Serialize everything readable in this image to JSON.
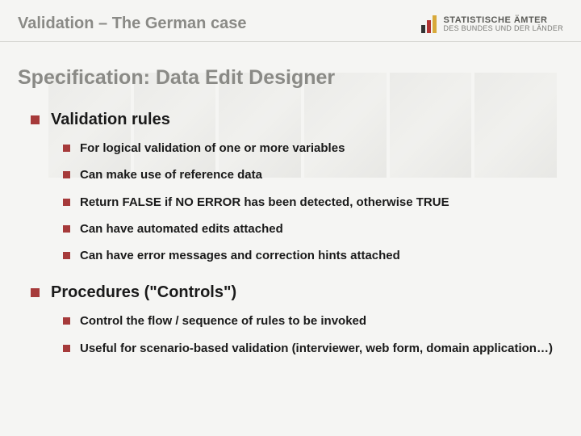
{
  "header": {
    "title": "Validation – The German case",
    "logo": {
      "line1": "STATISTISCHE ÄMTER",
      "line2": "DES BUNDES UND DER LÄNDER"
    }
  },
  "slide": {
    "title": "Specification: Data Edit Designer",
    "sections": [
      {
        "heading": "Validation rules",
        "items": [
          "For logical validation of one or more variables",
          "Can make use of reference data",
          "Return FALSE if NO ERROR has been detected, otherwise TRUE",
          "Can have automated edits attached",
          "Can have error messages and correction hints attached"
        ]
      },
      {
        "heading": "Procedures (\"Controls\")",
        "items": [
          "Control the flow / sequence of rules to be invoked",
          "Useful for scenario-based validation (interviewer, web form, domain application…)"
        ]
      }
    ]
  }
}
